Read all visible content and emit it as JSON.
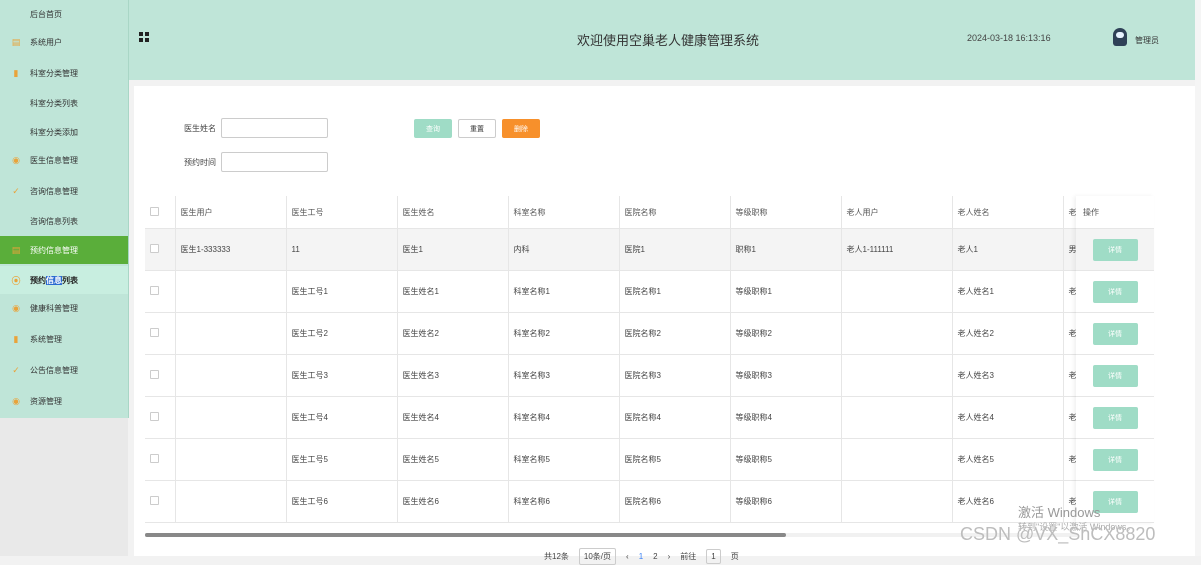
{
  "sidebar": {
    "items": [
      {
        "label": "后台首页",
        "icon": "home-icon",
        "sub": true
      },
      {
        "label": "系统用户",
        "icon": "doc-icon"
      },
      {
        "label": "科室分类管理",
        "icon": "bar-chart-icon"
      },
      {
        "label": "科室分类列表",
        "sub": true
      },
      {
        "label": "科室分类添加",
        "sub": true
      },
      {
        "label": "医生信息管理",
        "icon": "chat-icon"
      },
      {
        "label": "咨询信息管理",
        "icon": "check-circle-icon"
      },
      {
        "label": "咨询信息列表",
        "sub": true
      },
      {
        "label": "预约信息管理",
        "icon": "doc-icon",
        "active": true
      },
      {
        "label_pre": "预约",
        "label_sel": "信息",
        "label_post": "列表",
        "icon": "location-icon",
        "hover": true
      },
      {
        "label": "健康科普管理",
        "icon": "chat-icon"
      },
      {
        "label": "系统管理",
        "icon": "bar-chart-icon"
      },
      {
        "label": "公告信息管理",
        "icon": "check-circle-icon"
      },
      {
        "label": "资源管理",
        "icon": "chat-icon"
      }
    ]
  },
  "header": {
    "title": "欢迎使用空巢老人健康管理系统",
    "datetime": "2024-03-18 16:13:16",
    "user": "管理员",
    "menu_icon": "grid-icon",
    "avatar_icon": "robot-avatar-icon"
  },
  "search": {
    "doctor_name_label": "医生姓名",
    "appoint_time_label": "预约时间",
    "search_btn": "查询",
    "reset_btn": "重置",
    "delete_btn": "删除"
  },
  "table": {
    "headers": [
      "医生用户",
      "医生工号",
      "医生姓名",
      "科室名称",
      "医院名称",
      "等级职称",
      "老人用户",
      "老人姓名",
      "老..."
    ],
    "op_header": "操作",
    "detail_btn": "详情",
    "rows": [
      [
        "医生1-333333",
        "11",
        "医生1",
        "内科",
        "医院1",
        "职称1",
        "老人1-111111",
        "老人1",
        "男"
      ],
      [
        "",
        "医生工号1",
        "医生姓名1",
        "科室名称1",
        "医院名称1",
        "等级职称1",
        "",
        "老人姓名1",
        "老..."
      ],
      [
        "",
        "医生工号2",
        "医生姓名2",
        "科室名称2",
        "医院名称2",
        "等级职称2",
        "",
        "老人姓名2",
        "老..."
      ],
      [
        "",
        "医生工号3",
        "医生姓名3",
        "科室名称3",
        "医院名称3",
        "等级职称3",
        "",
        "老人姓名3",
        "老..."
      ],
      [
        "",
        "医生工号4",
        "医生姓名4",
        "科室名称4",
        "医院名称4",
        "等级职称4",
        "",
        "老人姓名4",
        "老..."
      ],
      [
        "",
        "医生工号5",
        "医生姓名5",
        "科室名称5",
        "医院名称5",
        "等级职称5",
        "",
        "老人姓名5",
        "老..."
      ],
      [
        "",
        "医生工号6",
        "医生姓名6",
        "科室名称6",
        "医院名称6",
        "等级职称6",
        "",
        "老人姓名6",
        "老..."
      ]
    ]
  },
  "pager": {
    "total": "共12条",
    "page_size": "10条/页",
    "prev": "‹",
    "next": "›",
    "pages": [
      "1",
      "2"
    ],
    "goto_label": "前往",
    "goto_value": "1",
    "goto_suffix": "页"
  },
  "overlay": {
    "watermark_title": "激活 Windows",
    "watermark_sub": "转到\"设置\"以激活 Windows。",
    "csdn": "CSDN @VX_ShCX8820"
  },
  "colors": {
    "sidebar_bg": "#bfe5d8",
    "active_item": "#5aae3a",
    "primary_btn": "#9fdcc6",
    "delete_btn": "#f7902b"
  }
}
